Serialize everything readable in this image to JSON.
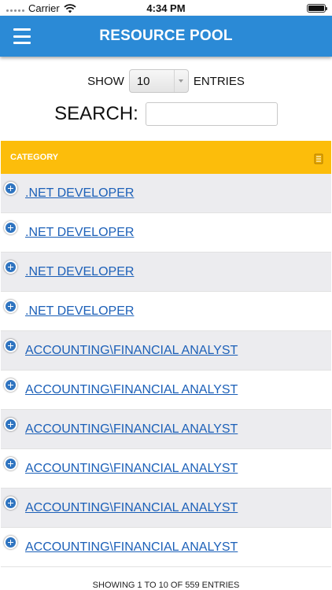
{
  "status_bar": {
    "carrier": "Carrier",
    "time": "4:34 PM",
    "battery_level": 1.0
  },
  "header": {
    "title": "RESOURCE POOL",
    "menu_icon": "hamburger-menu-icon"
  },
  "controls": {
    "show_label": "SHOW",
    "page_length_value": "10",
    "entries_label": "ENTRIES",
    "search_label": "SEARCH:",
    "search_value": ""
  },
  "table": {
    "column_header": "CATEGORY",
    "header_color": "#fcbd0b",
    "rows": [
      ".NET DEVELOPER",
      ".NET DEVELOPER",
      ".NET DEVELOPER",
      ".NET DEVELOPER",
      "ACCOUNTING\\FINANCIAL ANALYST",
      "ACCOUNTING\\FINANCIAL ANALYST",
      "ACCOUNTING\\FINANCIAL ANALYST",
      "ACCOUNTING\\FINANCIAL ANALYST",
      "ACCOUNTING\\FINANCIAL ANALYST",
      "ACCOUNTING\\FINANCIAL ANALYST"
    ]
  },
  "footer": {
    "info": "SHOWING 1 TO 10 OF 559 ENTRIES"
  },
  "colors": {
    "header_bar": "#2b8ad6",
    "link": "#1c60b8",
    "row_alt": "#ececef"
  }
}
